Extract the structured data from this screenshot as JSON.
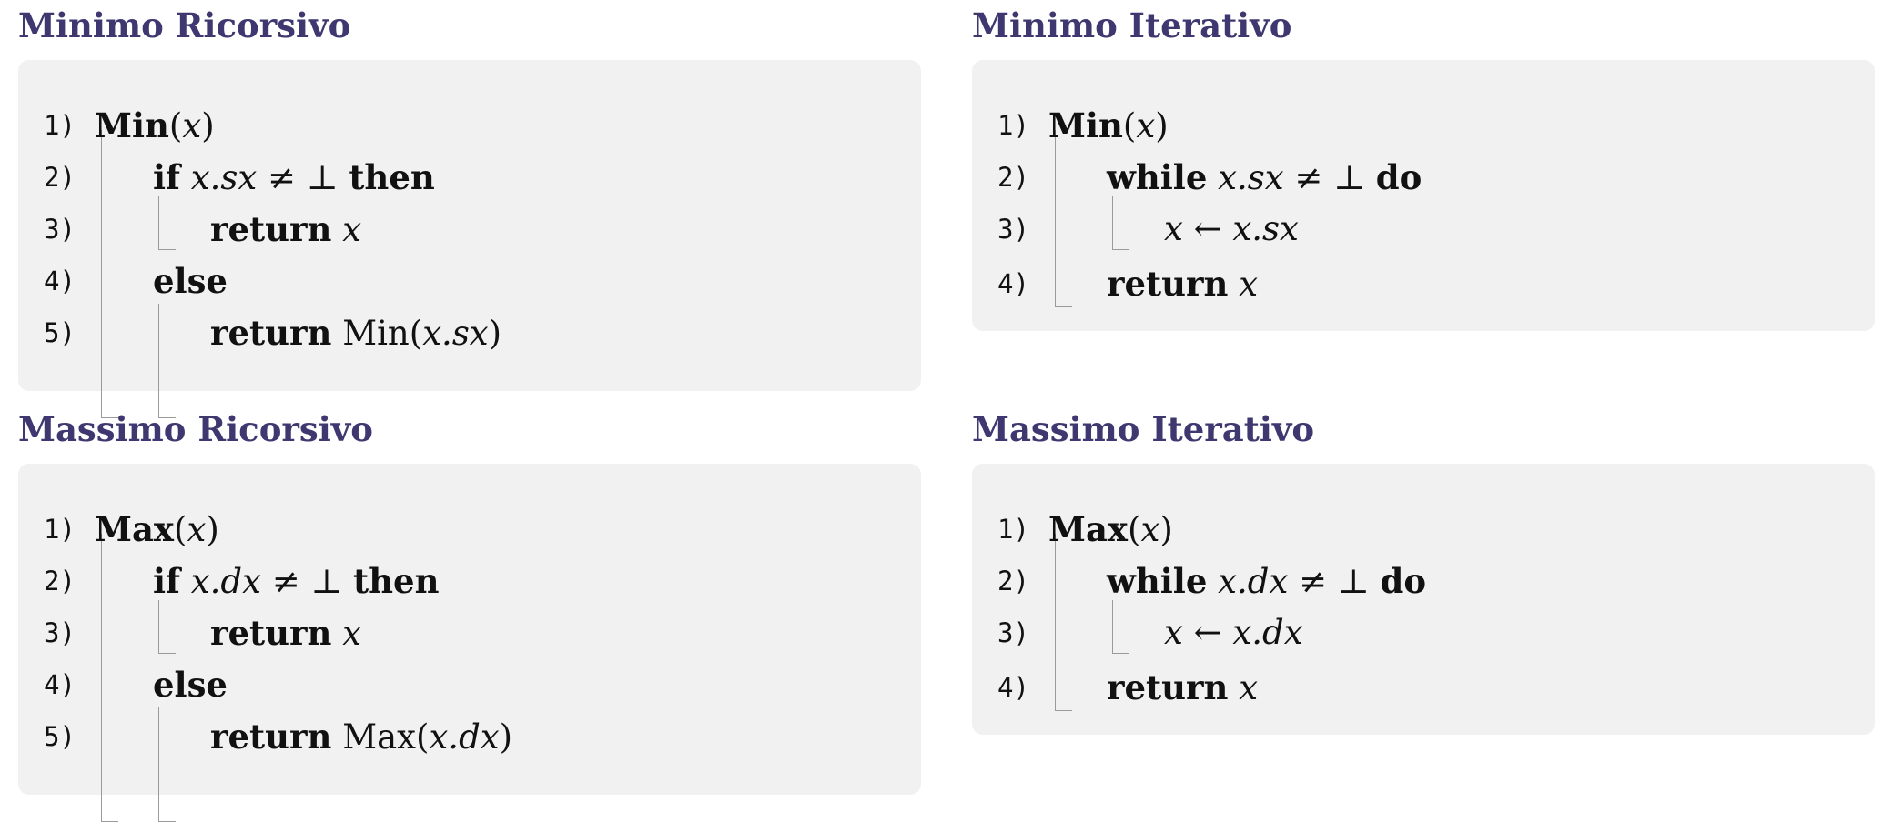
{
  "sections": {
    "min_rec": {
      "title": "Minimo Ricorsivo",
      "lines": {
        "l1": {
          "num": "1)",
          "fn": "Min",
          "open": "(",
          "arg": "x",
          "close": ")"
        },
        "l2": {
          "num": "2)",
          "kw1": "if",
          "lhs": "x.sx",
          "neq": "≠",
          "bot": "⊥",
          "kw2": "then"
        },
        "l3": {
          "num": "3)",
          "kw": "return",
          "val": "x"
        },
        "l4": {
          "num": "4)",
          "kw": "else"
        },
        "l5": {
          "num": "5)",
          "kw": "return",
          "fn": "Min",
          "open": "(",
          "arg": "x.sx",
          "close": ")"
        }
      }
    },
    "min_it": {
      "title": "Minimo Iterativo",
      "lines": {
        "l1": {
          "num": "1)",
          "fn": "Min",
          "open": "(",
          "arg": "x",
          "close": ")"
        },
        "l2": {
          "num": "2)",
          "kw1": "while",
          "lhs": "x.sx",
          "neq": "≠",
          "bot": "⊥",
          "kw2": "do"
        },
        "l3": {
          "num": "3)",
          "lhs": "x",
          "arrow": "←",
          "rhs": "x.sx"
        },
        "l4": {
          "num": "4)",
          "kw": "return",
          "val": "x"
        }
      }
    },
    "max_rec": {
      "title": "Massimo Ricorsivo",
      "lines": {
        "l1": {
          "num": "1)",
          "fn": "Max",
          "open": "(",
          "arg": "x",
          "close": ")"
        },
        "l2": {
          "num": "2)",
          "kw1": "if",
          "lhs": "x.dx",
          "neq": "≠",
          "bot": "⊥",
          "kw2": "then"
        },
        "l3": {
          "num": "3)",
          "kw": "return",
          "val": "x"
        },
        "l4": {
          "num": "4)",
          "kw": "else"
        },
        "l5": {
          "num": "5)",
          "kw": "return",
          "fn": "Max",
          "open": "(",
          "arg": "x.dx",
          "close": ")"
        }
      }
    },
    "max_it": {
      "title": "Massimo Iterativo",
      "lines": {
        "l1": {
          "num": "1)",
          "fn": "Max",
          "open": "(",
          "arg": "x",
          "close": ")"
        },
        "l2": {
          "num": "2)",
          "kw1": "while",
          "lhs": "x.dx",
          "neq": "≠",
          "bot": "⊥",
          "kw2": "do"
        },
        "l3": {
          "num": "3)",
          "lhs": "x",
          "arrow": "←",
          "rhs": "x.dx"
        },
        "l4": {
          "num": "4)",
          "kw": "return",
          "val": "x"
        }
      }
    }
  },
  "colors": {
    "title": "#3f3870",
    "box_background": "#f1f1f1",
    "rule": "#9a9a9a"
  }
}
